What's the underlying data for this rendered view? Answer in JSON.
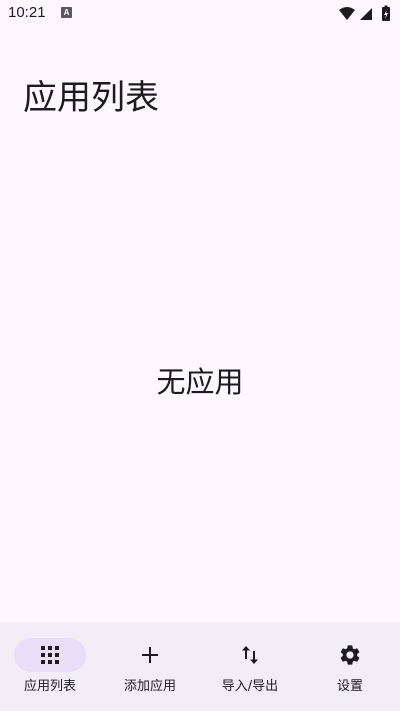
{
  "status_bar": {
    "time": "10:21",
    "notification_icon": "A"
  },
  "page": {
    "title": "应用列表",
    "empty_message": "无应用"
  },
  "bottom_nav": {
    "items": [
      {
        "label": "应用列表",
        "icon": "grid-icon",
        "active": true
      },
      {
        "label": "添加应用",
        "icon": "plus-icon",
        "active": false
      },
      {
        "label": "导入/导出",
        "icon": "swap-vertical-icon",
        "active": false
      },
      {
        "label": "设置",
        "icon": "gear-icon",
        "active": false
      }
    ]
  },
  "colors": {
    "background": "#fef7ff",
    "nav_background": "#f3edf7",
    "active_indicator": "#e8def8",
    "text": "#1d1b20"
  }
}
